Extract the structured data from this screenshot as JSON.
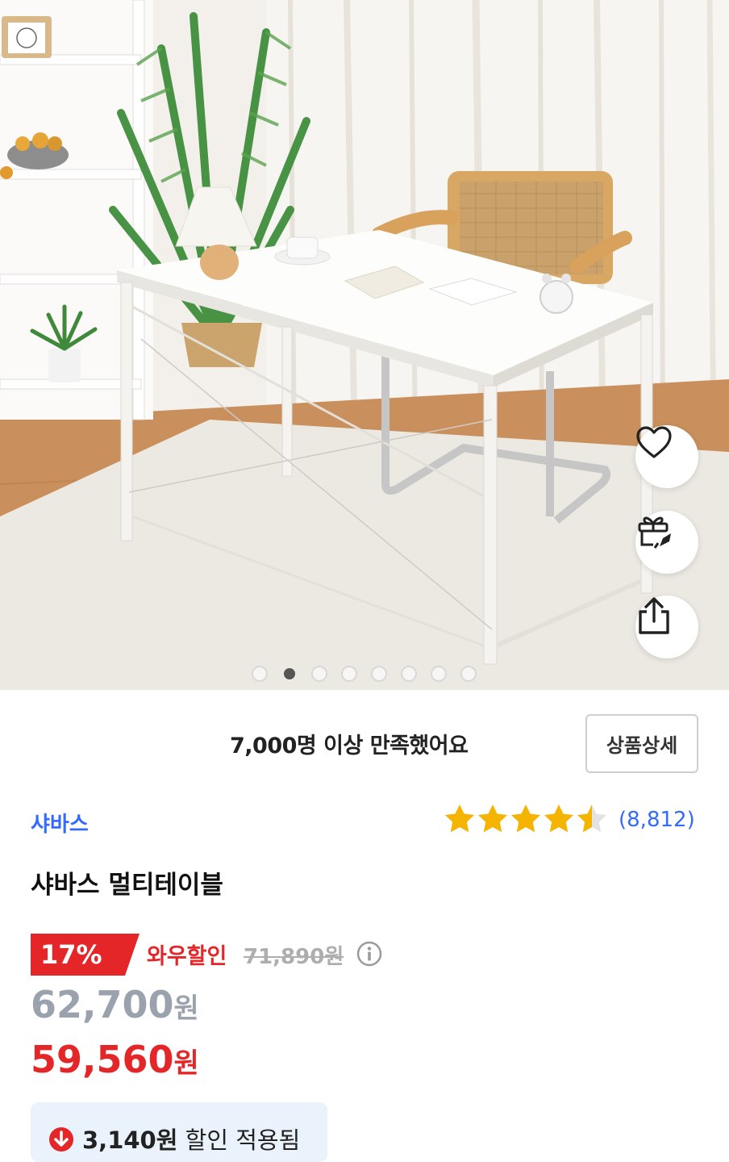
{
  "product_image": {
    "carousel_total": 8,
    "carousel_active_index": 1
  },
  "floating_actions": {
    "wish_icon": "heart-icon",
    "gift_icon": "gift-rocket-icon",
    "share_icon": "share-icon"
  },
  "satisfaction": {
    "message": "7,000명 이상 만족했어요",
    "detail_button": "상품상세"
  },
  "brand": "샤바스",
  "rating": {
    "stars": 4.5,
    "max_stars": 5,
    "review_count": "(8,812)"
  },
  "title": "샤바스 멀티테이블",
  "price": {
    "discount_rate": "17%",
    "discount_label": "와우할인",
    "original_price": "71,890원",
    "sale_price_number": "62,700",
    "sale_price_unit": "원",
    "wow_price_number": "59,560",
    "wow_price_unit": "원",
    "applied_amount": "3,140원",
    "applied_suffix": "할인 적용됨"
  },
  "colors": {
    "accent_blue": "#346aff",
    "sale_red": "#e52628",
    "star_yellow": "#f5b400",
    "muted_gray": "#9aa2ad"
  }
}
